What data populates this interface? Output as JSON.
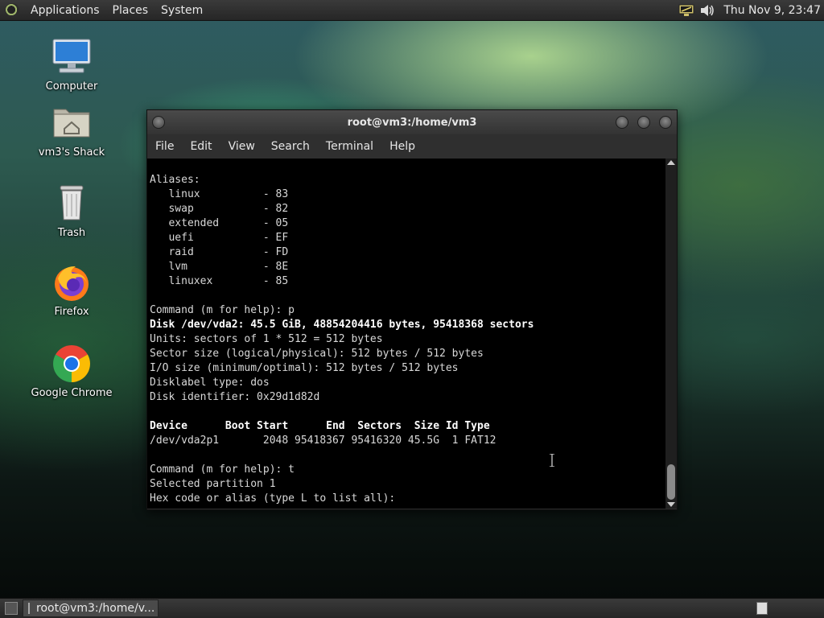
{
  "top_panel": {
    "menus": [
      "Applications",
      "Places",
      "System"
    ],
    "clock": "Thu Nov 9, 23:47"
  },
  "desktop": {
    "icons": [
      {
        "label": "Computer",
        "icon": "computer-icon"
      },
      {
        "label": "vm3's Shack",
        "icon": "home-folder-icon"
      },
      {
        "label": "Trash",
        "icon": "trash-icon"
      },
      {
        "label": "Firefox",
        "icon": "firefox-icon"
      },
      {
        "label": "Google Chrome",
        "icon": "chrome-icon"
      }
    ]
  },
  "window": {
    "title": "root@vm3:/home/vm3",
    "menus": [
      "File",
      "Edit",
      "View",
      "Search",
      "Terminal",
      "Help"
    ],
    "terminal_lines": [
      {
        "text": "Aliases:",
        "bold": false
      },
      {
        "text": "   linux          - 83",
        "bold": false
      },
      {
        "text": "   swap           - 82",
        "bold": false
      },
      {
        "text": "   extended       - 05",
        "bold": false
      },
      {
        "text": "   uefi           - EF",
        "bold": false
      },
      {
        "text": "   raid           - FD",
        "bold": false
      },
      {
        "text": "   lvm            - 8E",
        "bold": false
      },
      {
        "text": "   linuxex        - 85",
        "bold": false
      },
      {
        "text": "",
        "bold": false
      },
      {
        "text": "Command (m for help): p",
        "bold": false
      },
      {
        "text": "Disk /dev/vda2: 45.5 GiB, 48854204416 bytes, 95418368 sectors",
        "bold": true
      },
      {
        "text": "Units: sectors of 1 * 512 = 512 bytes",
        "bold": false
      },
      {
        "text": "Sector size (logical/physical): 512 bytes / 512 bytes",
        "bold": false
      },
      {
        "text": "I/O size (minimum/optimal): 512 bytes / 512 bytes",
        "bold": false
      },
      {
        "text": "Disklabel type: dos",
        "bold": false
      },
      {
        "text": "Disk identifier: 0x29d1d82d",
        "bold": false
      },
      {
        "text": "",
        "bold": false
      },
      {
        "text": "Device      Boot Start      End  Sectors  Size Id Type",
        "bold": true
      },
      {
        "text": "/dev/vda2p1       2048 95418367 95416320 45.5G  1 FAT12",
        "bold": false
      },
      {
        "text": "",
        "bold": false
      },
      {
        "text": "Command (m for help): t",
        "bold": false
      },
      {
        "text": "Selected partition 1",
        "bold": false
      },
      {
        "text": "Hex code or alias (type L to list all): ",
        "bold": false
      }
    ]
  },
  "bottom_panel": {
    "task_label": "root@vm3:/home/v..."
  }
}
